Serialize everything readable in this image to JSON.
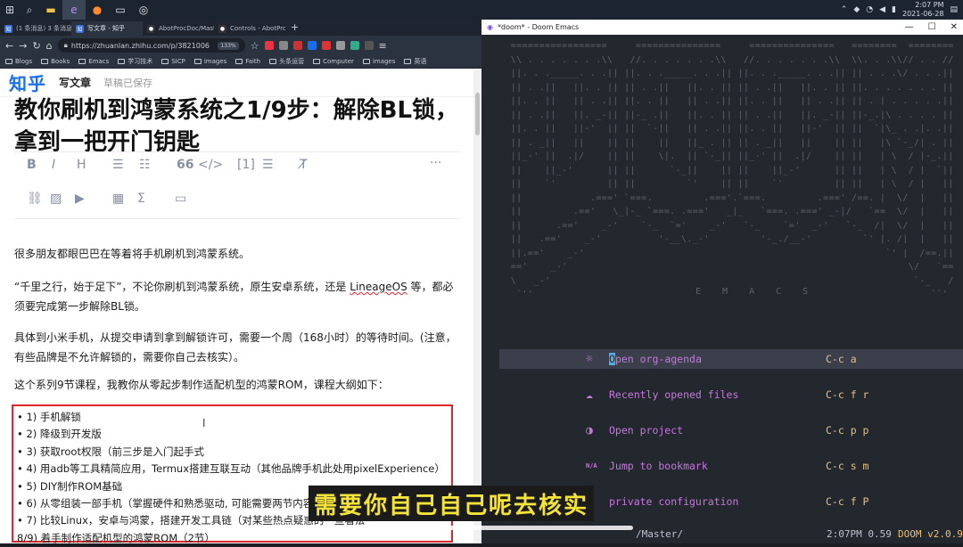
{
  "taskbar": {
    "items": [
      "(1 条消息) 3 条...",
      "写文章 - 知乎",
      "AbotProcDoc/Master",
      "Controls - AbotProcDo"
    ],
    "clock": {
      "time": "2:07 PM",
      "date": "2021-06-28"
    }
  },
  "browser": {
    "tabs": [
      "(1 条消息) 3 条消息",
      "写文章 - 知乎",
      "AbotProcDoc/Master",
      "Controls - AbotProcDo"
    ],
    "url": "https://zhuanlan.zhihu.com/p/3821006",
    "zoom": "133%",
    "bookmarks": [
      "Blogs",
      "Books",
      "Emacs",
      "学习技术",
      "SICP",
      "images",
      "Faith",
      "头条运营",
      "Computer",
      "images",
      "英语"
    ]
  },
  "zhihu": {
    "logo": "知乎",
    "write": "写文章",
    "saved": "草稿已保存",
    "title": "教你刷机到鸿蒙系统之1/9步：解除BL锁，拿到一把开门钥匙",
    "toolbar_row1": [
      "B",
      "I",
      "H",
      "66",
      "</>",
      "[1]"
    ],
    "para1": "很多朋友都眼巴巴在等着将手机刷机到鸿蒙系统。",
    "para2a": "“千里之行，始于足下”，不论你刷机到鸿蒙系统，原生安卓系统，还是 ",
    "para2_link": "LineageOS",
    "para2b": " 等，都必须要完成第一步解除BL锁。",
    "para3": "具体到小米手机，从提交申请到拿到解锁许可，需要一个周（168小时）的等待时间。(注意，有些品牌是不允许解锁的，需要你自己去核实）。",
    "para4": "这个系列9节课程，我教你从零起步制作适配机型的鸿蒙ROM，课程大纲如下：",
    "outline": [
      "• 1) 手机解锁",
      "• 2) 降级到开发版",
      "• 3) 获取root权限（前三步是入门起手式",
      "• 4) 用adb等工具精简应用，Termux搭建互联互动（其他品牌手机此处用pixelExperience）",
      "• 5) DIY制作ROM基础",
      "• 6) 从零组装一部手机（掌握硬件和熟悉驱动, 可能需要两节内容",
      "• 7) 比较Linux，安卓与鸿蒙，搭建开发工具链（对某些热点疑惑的一些看法",
      "8/9) 着手制作适配机型的鸿蒙ROM（2节）"
    ],
    "cursor_glyph": "I"
  },
  "emacs": {
    "window_title": "*doom* - Doom Emacs",
    "banner_word": "E M A C S",
    "menu": [
      {
        "icon": "☼",
        "label": "Open org-agenda",
        "key": "C-c a"
      },
      {
        "icon": "☁",
        "label": "Recently opened files",
        "key": "C-c f r"
      },
      {
        "icon": "◑",
        "label": "Open project",
        "key": "C-c p p"
      },
      {
        "icon": "N/A",
        "label": "Jump to bookmark",
        "key": "C-c s m"
      },
      {
        "icon": "",
        "label": "private configuration",
        "key": "C-c f P"
      }
    ],
    "modeline": {
      "path": "/Master/",
      "time": "2:07PM 0.59",
      "version": "DOOM v2.0.9"
    }
  },
  "subtitle": "需要你自己自己呢去核实"
}
